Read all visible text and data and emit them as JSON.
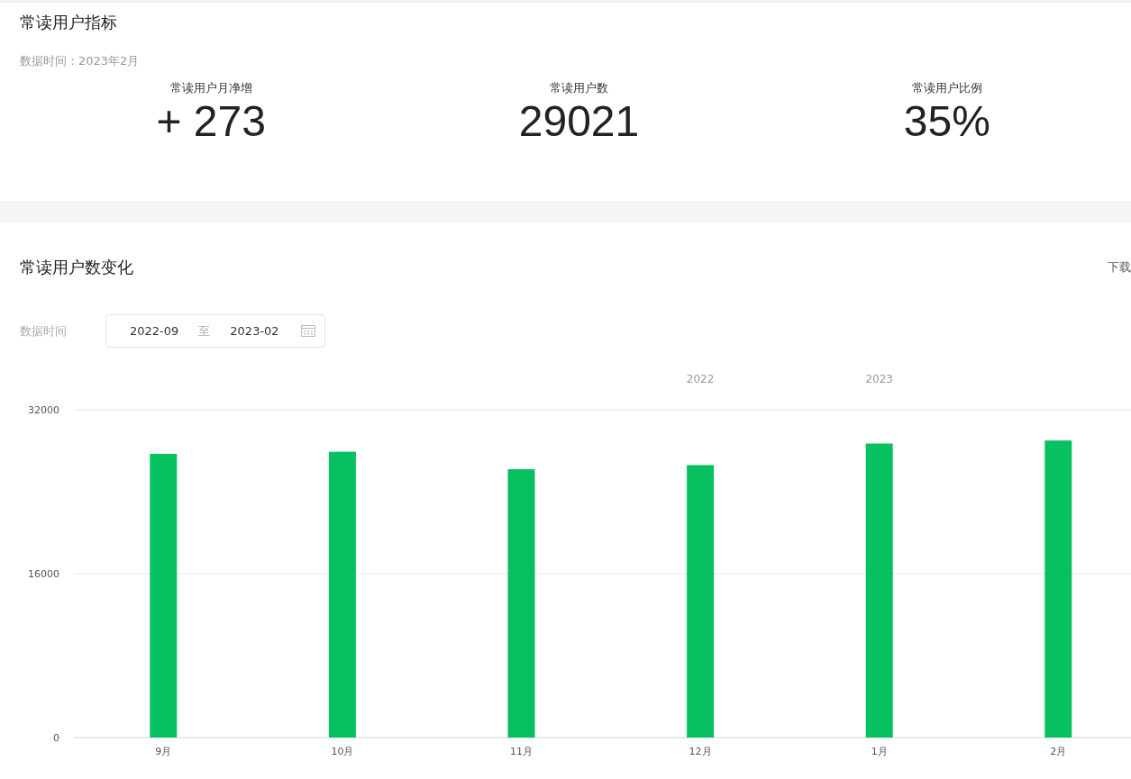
{
  "metrics_card": {
    "title": "常读用户指标",
    "data_time": "数据时间：2023年2月",
    "metrics": [
      {
        "label": "常读用户月净增",
        "value": "+ 273"
      },
      {
        "label": "常读用户数",
        "value": "29021"
      },
      {
        "label": "常读用户比例",
        "value": "35%"
      }
    ]
  },
  "trend_card": {
    "title": "常读用户数变化",
    "download": "下载",
    "date_filter": {
      "label": "数据时间",
      "start": "2022-09",
      "separator": "至",
      "end": "2023-02"
    },
    "chart_data": {
      "type": "bar",
      "categories": [
        "9月",
        "10月",
        "11月",
        "12月",
        "1月",
        "2月"
      ],
      "series": [
        {
          "color": "#07c160",
          "values": [
            27700,
            27900,
            26200,
            26600,
            28700,
            29000
          ]
        }
      ],
      "ylim": [
        0,
        32000
      ],
      "yticks": [
        0,
        16000,
        32000
      ]
    },
    "year_labels": [
      "2022",
      "2023"
    ]
  }
}
